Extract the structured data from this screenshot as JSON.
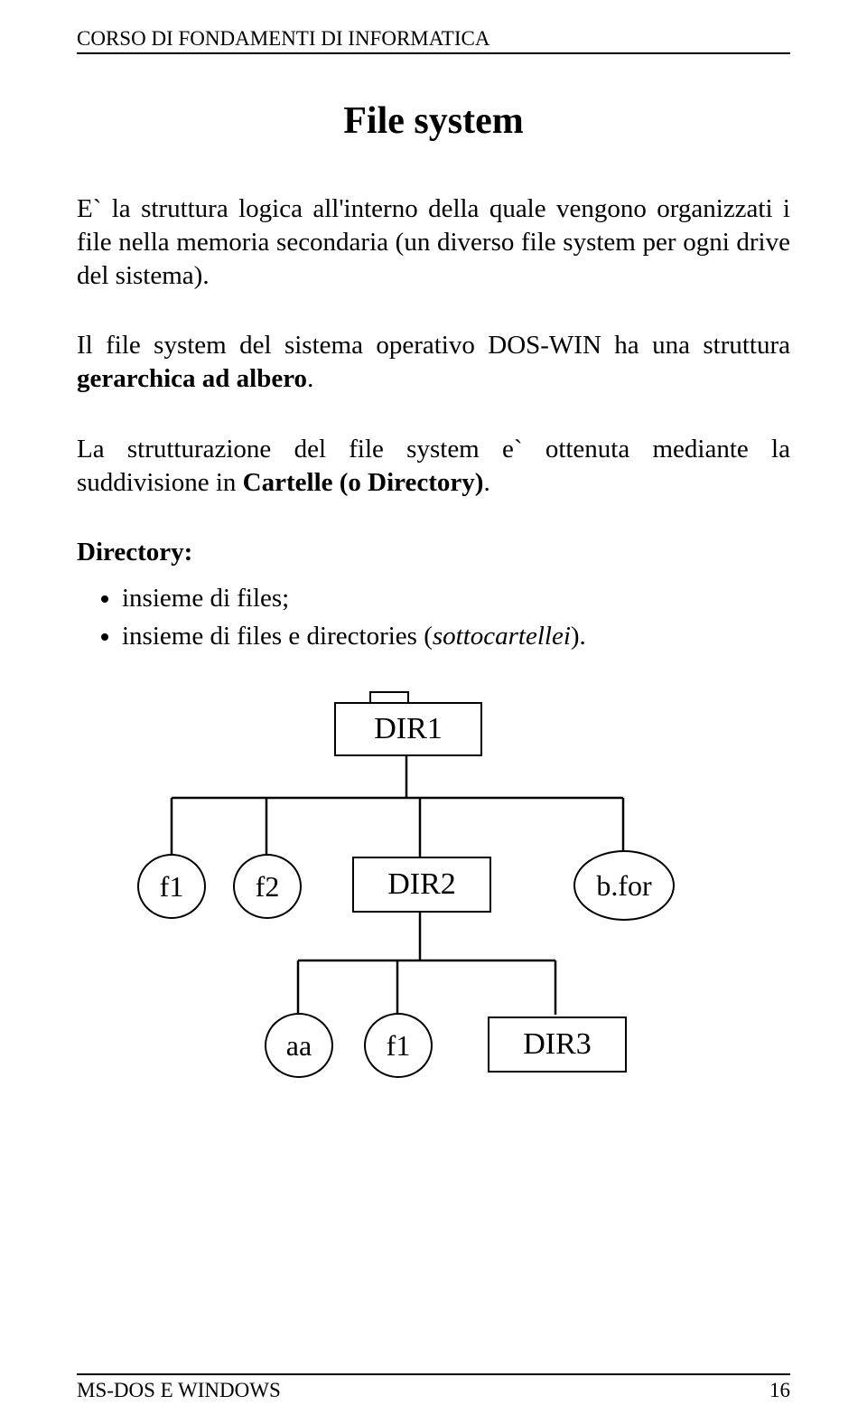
{
  "header": "CORSO DI FONDAMENTI DI INFORMATICA",
  "title": "File system",
  "para1_a": "E` la struttura logica all'interno della quale vengono organizzati i file nella memoria secondaria (un diverso file system per ogni drive del sistema).",
  "para2_a": "Il file system del sistema operativo DOS-WIN ha una struttura ",
  "para2_b": "gerarchica ad albero",
  "para2_c": ".",
  "para3_a": "La strutturazione del file system e` ottenuta mediante la suddivisione in ",
  "para3_b": "Cartelle (o Directory)",
  "para3_c": ".",
  "dir_heading": "Directory:",
  "bullet1": "insieme di files;",
  "bullet2_a": "insieme di files e directories (",
  "bullet2_b": "sottocartellei",
  "bullet2_c": ").",
  "chart_data": {
    "type": "tree",
    "nodes": {
      "DIR1": {
        "label": "DIR1",
        "shape": "box",
        "children": [
          "f1_a",
          "f2",
          "DIR2",
          "bfor"
        ]
      },
      "f1_a": {
        "label": "f1",
        "shape": "circle"
      },
      "f2": {
        "label": "f2",
        "shape": "circle"
      },
      "DIR2": {
        "label": "DIR2",
        "shape": "box",
        "children": [
          "aa",
          "f1_b",
          "DIR3"
        ]
      },
      "bfor": {
        "label": "b.for",
        "shape": "circle"
      },
      "aa": {
        "label": "aa",
        "shape": "circle"
      },
      "f1_b": {
        "label": "f1",
        "shape": "circle"
      },
      "DIR3": {
        "label": "DIR3",
        "shape": "box"
      }
    }
  },
  "footer_left": "MS-DOS  E WINDOWS",
  "footer_right": "16"
}
